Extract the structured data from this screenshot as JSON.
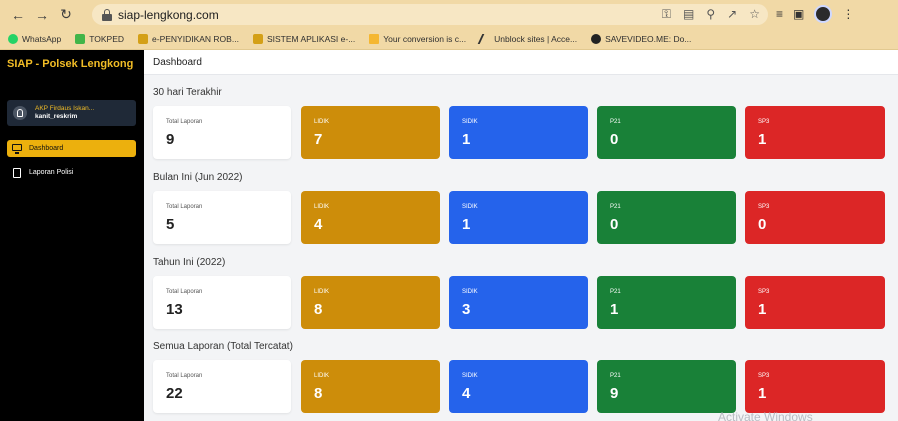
{
  "browser": {
    "url": "siap-lengkong.com",
    "bookmarks": [
      {
        "label": "WhatsApp",
        "icon": "whatsapp-icon",
        "color": "#25d366"
      },
      {
        "label": "TOKPED",
        "icon": "tokopedia-icon",
        "color": "#42b549"
      },
      {
        "label": "e-PENYIDIKAN ROB...",
        "icon": "police-badge-icon",
        "color": "#d4a017"
      },
      {
        "label": "SISTEM APLIKASI e-...",
        "icon": "police-badge-icon",
        "color": "#d4a017"
      },
      {
        "label": "Your conversion is c...",
        "icon": "folder-icon",
        "color": "#f5b731"
      },
      {
        "label": "Unblock sites | Acce...",
        "icon": "unblock-icon",
        "color": "#333333"
      },
      {
        "label": "SAVEVIDEO.ME: Do...",
        "icon": "savevideo-icon",
        "color": "#222222"
      }
    ]
  },
  "sidebar": {
    "brand": "SIAP - Polsek Lengkong",
    "user_name": "AKP Firdaus Iskan...",
    "user_role": "kanit_reskrim",
    "menu": [
      {
        "label": "Dashboard",
        "icon": "monitor-icon",
        "active": true
      },
      {
        "label": "Laporan Polisi",
        "icon": "document-icon",
        "active": false
      }
    ]
  },
  "header": {
    "title": "Dashboard"
  },
  "sections": [
    {
      "title": "30 hari Terakhir",
      "total_label": "Total Laporan",
      "total": "9",
      "lidik_label": "LIDIK",
      "lidik": "7",
      "sidik_label": "SIDIK",
      "sidik": "1",
      "p21_label": "P21",
      "p21": "0",
      "sp3_label": "SP3",
      "sp3": "1"
    },
    {
      "title": "Bulan Ini (Jun 2022)",
      "total_label": "Total Laporan",
      "total": "5",
      "lidik_label": "LIDIK",
      "lidik": "4",
      "sidik_label": "SIDIK",
      "sidik": "1",
      "p21_label": "P21",
      "p21": "0",
      "sp3_label": "SP3",
      "sp3": "0"
    },
    {
      "title": "Tahun Ini (2022)",
      "total_label": "Total Laporan",
      "total": "13",
      "lidik_label": "LIDIK",
      "lidik": "8",
      "sidik_label": "SIDIK",
      "sidik": "3",
      "p21_label": "P21",
      "p21": "1",
      "sp3_label": "SP3",
      "sp3": "1"
    },
    {
      "title": "Semua Laporan (Total Tercatat)",
      "total_label": "Total Laporan",
      "total": "22",
      "lidik_label": "LIDIK",
      "lidik": "8",
      "sidik_label": "SIDIK",
      "sidik": "4",
      "p21_label": "P21",
      "p21": "9",
      "sp3_label": "SP3",
      "sp3": "1"
    }
  ],
  "colors": {
    "brand": "#f2bd26",
    "lidik": "#cd8d0a",
    "sidik": "#2563eb",
    "p21": "#198138",
    "sp3": "#dc2626"
  },
  "watermark": "Activate Windows"
}
